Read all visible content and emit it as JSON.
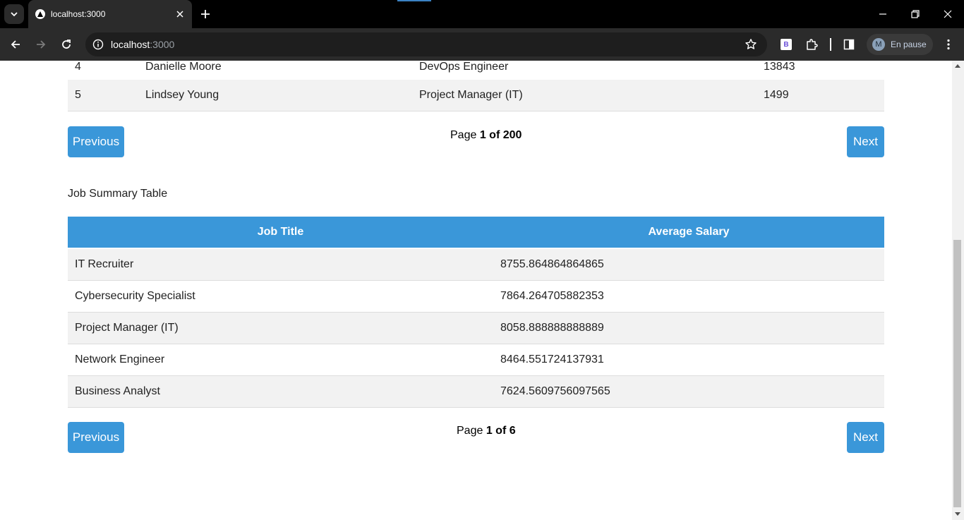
{
  "browser": {
    "tab_title": "localhost:3000",
    "url_host": "localhost",
    "url_port": ":3000",
    "profile_initial": "M",
    "profile_status": "En pause",
    "extension_badge": "B"
  },
  "employees_table": {
    "rows": [
      {
        "id": "4",
        "name": "Danielle Moore",
        "title": "DevOps Engineer",
        "salary": "13843"
      },
      {
        "id": "5",
        "name": "Lindsey Young",
        "title": "Project Manager (IT)",
        "salary": "1499"
      }
    ],
    "pagination": {
      "prev_label": "Previous",
      "next_label": "Next",
      "page_prefix": "Page",
      "page_current": "1 of 200"
    }
  },
  "job_summary": {
    "title": "Job Summary Table",
    "headers": {
      "job_title": "Job Title",
      "average_salary": "Average Salary"
    },
    "rows": [
      {
        "job_title": "IT Recruiter",
        "average_salary": "8755.864864864865"
      },
      {
        "job_title": "Cybersecurity Specialist",
        "average_salary": "7864.264705882353"
      },
      {
        "job_title": "Project Manager (IT)",
        "average_salary": "8058.888888888889"
      },
      {
        "job_title": "Network Engineer",
        "average_salary": "8464.551724137931"
      },
      {
        "job_title": "Business Analyst",
        "average_salary": "7624.5609756097565"
      }
    ],
    "pagination": {
      "prev_label": "Previous",
      "next_label": "Next",
      "page_prefix": "Page",
      "page_current": "1 of 6"
    }
  },
  "colors": {
    "accent": "#3a97d9",
    "row_alt": "#f2f2f2"
  }
}
